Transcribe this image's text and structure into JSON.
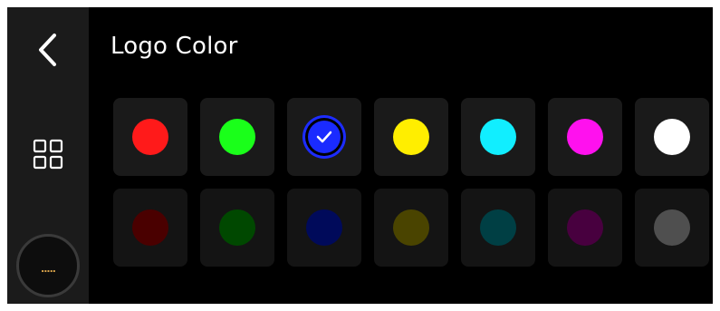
{
  "header": {
    "title": "Logo Color"
  },
  "sidebar": {
    "back_icon": "chevron-left-icon",
    "grid_icon": "grid-icon",
    "more_label": ".....",
    "more_color": "#d9a34a"
  },
  "selected_index": 2,
  "swatches": [
    {
      "name": "red",
      "color": "#ff1a1a"
    },
    {
      "name": "green",
      "color": "#1aff1a"
    },
    {
      "name": "blue",
      "color": "#1a2bff"
    },
    {
      "name": "yellow",
      "color": "#ffee00"
    },
    {
      "name": "cyan",
      "color": "#11eeff"
    },
    {
      "name": "magenta",
      "color": "#ff11ee"
    },
    {
      "name": "white",
      "color": "#ffffff"
    },
    {
      "name": "dark-red",
      "color": "#4a0000"
    },
    {
      "name": "dark-green",
      "color": "#004800"
    },
    {
      "name": "dark-blue",
      "color": "#000a5a"
    },
    {
      "name": "dark-yellow",
      "color": "#4a4400"
    },
    {
      "name": "dark-cyan",
      "color": "#003f44"
    },
    {
      "name": "dark-magenta",
      "color": "#48003f"
    },
    {
      "name": "gray",
      "color": "#4f4f4f"
    }
  ]
}
